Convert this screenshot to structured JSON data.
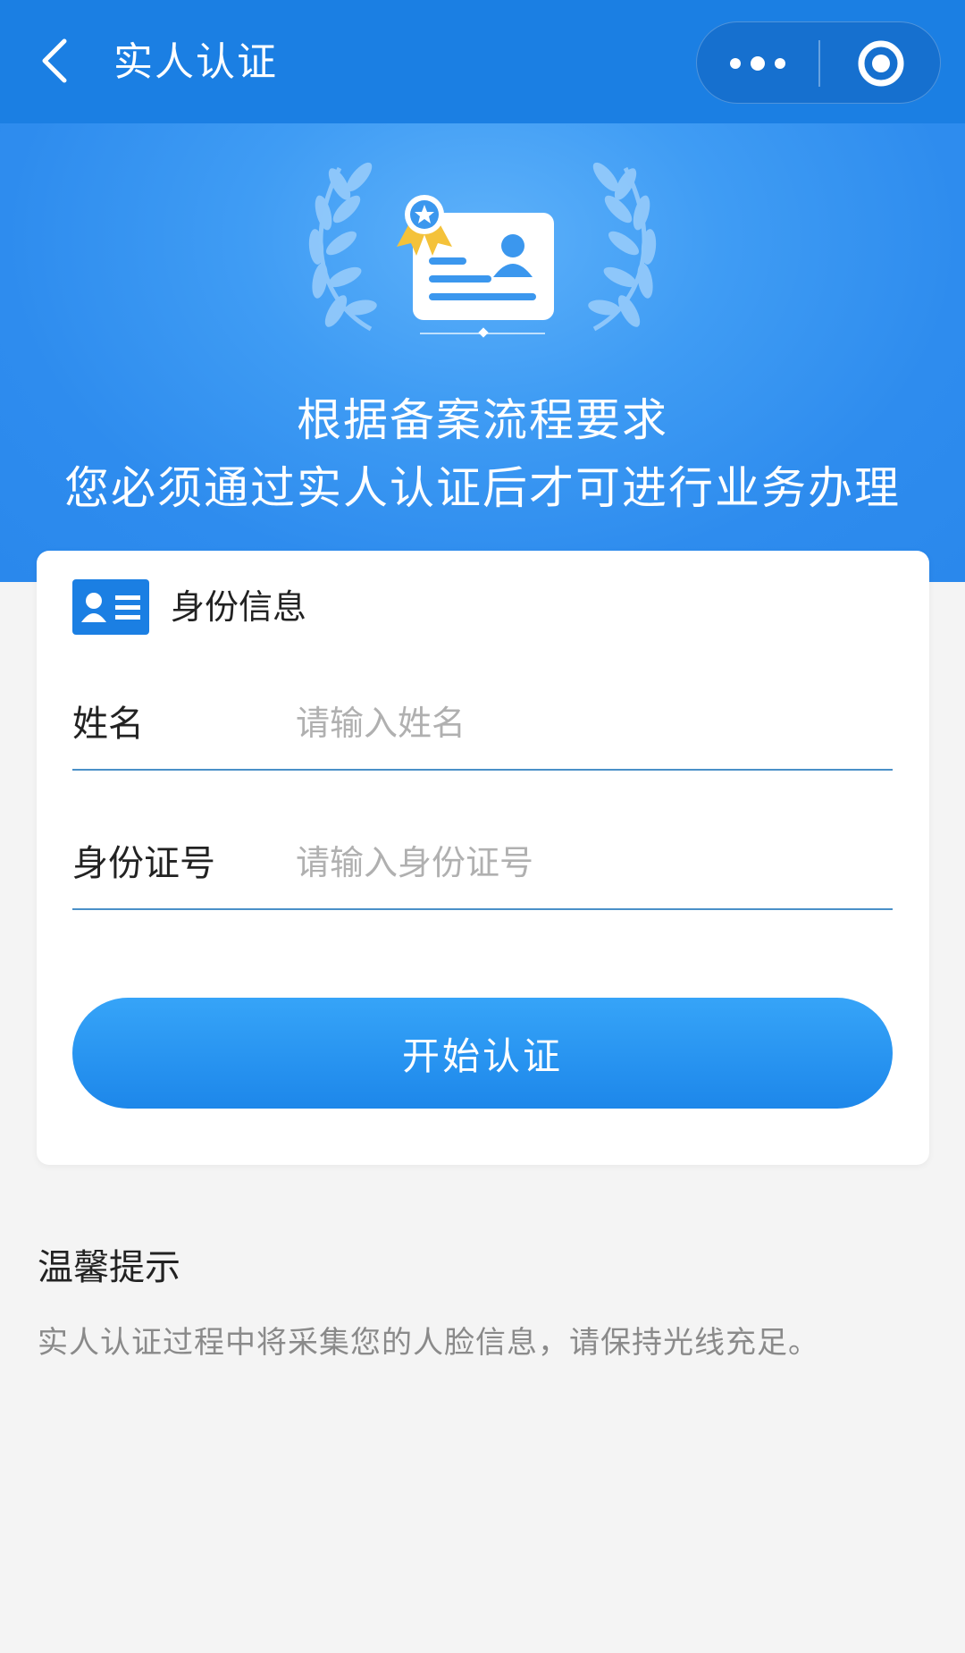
{
  "navbar": {
    "title": "实人认证",
    "icons": {
      "back": "chevron-left-icon",
      "more": "more-dots-icon",
      "close": "target-circle-icon"
    },
    "background_color": "#1b7fe3"
  },
  "hero": {
    "line1": "根据备案流程要求",
    "line2": "您必须通过实人认证后才可进行业务办理",
    "icons": {
      "illustration": "id-card-award-illustration"
    },
    "background_color": "#3f9cf4"
  },
  "identity_card": {
    "title": "身份信息",
    "icon": "id-card-icon",
    "fields": [
      {
        "label": "姓名",
        "placeholder": "请输入姓名",
        "value": ""
      },
      {
        "label": "身份证号",
        "placeholder": "请输入身份证号",
        "value": ""
      }
    ],
    "submit_label": "开始认证",
    "accent_color": "#1d87ea"
  },
  "tips": {
    "title": "温馨提示",
    "text": "实人认证过程中将采集您的人脸信息，请保持光线充足。"
  }
}
